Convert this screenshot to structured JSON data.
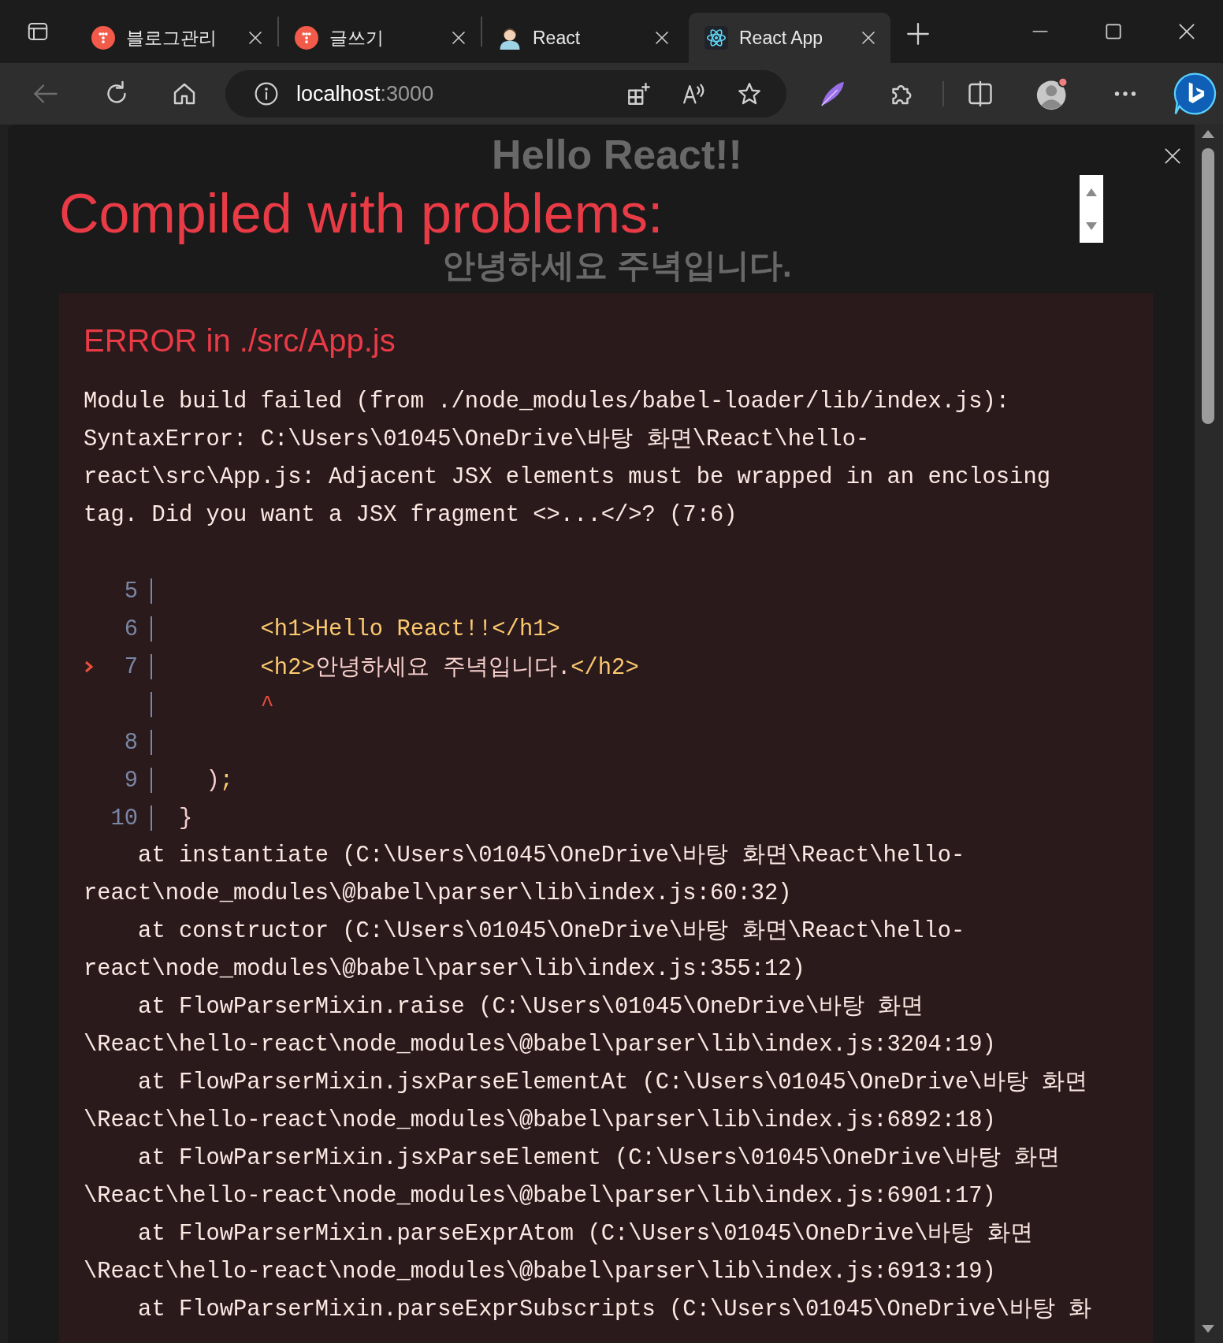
{
  "tabs": [
    {
      "kind": "blog",
      "title": "블로그관리",
      "selected": false
    },
    {
      "kind": "blog",
      "title": "글쓰기",
      "selected": false
    },
    {
      "kind": "person",
      "title": "React",
      "selected": false
    },
    {
      "kind": "react",
      "title": "React App",
      "selected": true
    }
  ],
  "nav": {
    "back": {
      "disabled": true
    }
  },
  "address": {
    "host": "localhost",
    "port": ":3000"
  },
  "page": {
    "heading": "Hello React!!",
    "subheading": "안녕하세요 주녁입니다."
  },
  "overlay": {
    "title": "Compiled with problems:",
    "error": {
      "title": "ERROR in ./src/App.js",
      "message": [
        "Module build failed (from ./node_modules/babel-loader/lib/index.js):",
        "SyntaxError: C:\\Users\\01045\\OneDrive\\바탕 화면\\React\\hello-",
        "react\\src\\App.js: Adjacent JSX elements must be wrapped in an enclosing",
        "tag. Did you want a JSX fragment <>...</>? (7:6)"
      ],
      "frame": [
        {
          "number": "5",
          "marked": false
        },
        {
          "number": "6",
          "marked": false,
          "tokens": [
            {
              "kind": "tag",
              "text": "      <h1>Hello React!!</h1>"
            }
          ]
        },
        {
          "number": "7",
          "marked": true,
          "tokens": [
            {
              "kind": "tag",
              "text": "      <h2>"
            },
            {
              "kind": "text",
              "text": "안녕하세요 주녁입니다."
            },
            {
              "kind": "tag",
              "text": "</h2>"
            }
          ]
        },
        {
          "marked": false,
          "tokens": [
            {
              "kind": "caret",
              "text": "      ^"
            }
          ]
        },
        {
          "number": "8",
          "marked": false
        },
        {
          "number": "9",
          "marked": false,
          "tokens": [
            {
              "kind": "text",
              "text": "  )"
            },
            {
              "kind": "tag",
              "text": ";"
            }
          ]
        },
        {
          "number": "10",
          "marked": false,
          "tokens": [
            {
              "kind": "text",
              "text": "}"
            }
          ]
        }
      ],
      "stack": [
        "    at instantiate (C:\\Users\\01045\\OneDrive\\바탕 화면\\React\\hello-",
        "react\\node_modules\\@babel\\parser\\lib\\index.js:60:32)",
        "    at constructor (C:\\Users\\01045\\OneDrive\\바탕 화면\\React\\hello-",
        "react\\node_modules\\@babel\\parser\\lib\\index.js:355:12)",
        "    at FlowParserMixin.raise (C:\\Users\\01045\\OneDrive\\바탕 화면",
        "\\React\\hello-react\\node_modules\\@babel\\parser\\lib\\index.js:3204:19)",
        "    at FlowParserMixin.jsxParseElementAt (C:\\Users\\01045\\OneDrive\\바탕 화면",
        "\\React\\hello-react\\node_modules\\@babel\\parser\\lib\\index.js:6892:18)",
        "    at FlowParserMixin.jsxParseElement (C:\\Users\\01045\\OneDrive\\바탕 화면",
        "\\React\\hello-react\\node_modules\\@babel\\parser\\lib\\index.js:6901:17)",
        "    at FlowParserMixin.parseExprAtom (C:\\Users\\01045\\OneDrive\\바탕 화면",
        "\\React\\hello-react\\node_modules\\@babel\\parser\\lib\\index.js:6913:19)",
        "    at FlowParserMixin.parseExprSubscripts (C:\\Users\\01045\\OneDrive\\바탕 화"
      ]
    }
  }
}
